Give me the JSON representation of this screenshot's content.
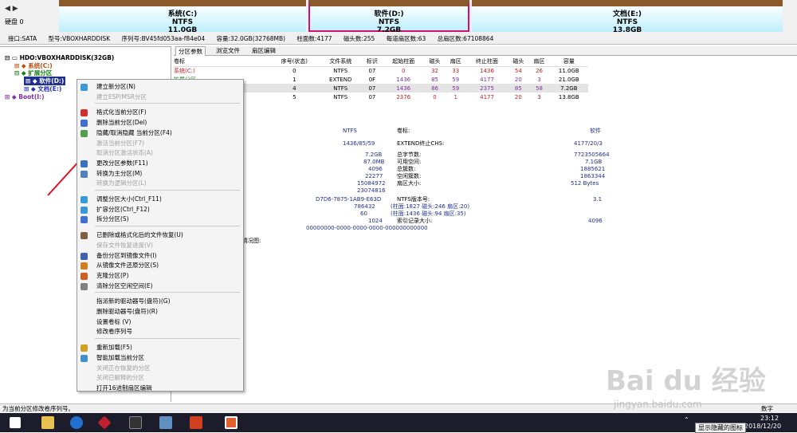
{
  "header": {
    "nav_left": "◀",
    "nav_right": "▶",
    "disk_label": "硬盘 0"
  },
  "partitions": [
    {
      "name": "系统(C:)",
      "fs": "NTFS",
      "size": "11.0GB"
    },
    {
      "name": "软件(D:)",
      "fs": "NTFS",
      "size": "7.2GB"
    },
    {
      "name": "文档(E:)",
      "fs": "NTFS",
      "size": "13.8GB"
    }
  ],
  "info": [
    "接口:SATA",
    "型号:VBOXHARDDISK",
    "序列号:BV45fd053aa-f84e04",
    "容量:32.0GB(32768MB)",
    "柱面数:4177",
    "磁头数:255",
    "每道扇区数:63",
    "总扇区数:67108864"
  ],
  "tree": {
    "root": "HDO:VBOXHARDDISK(32GB)",
    "c": "系统(C:)",
    "ext": "扩展分区",
    "d": "软件(D:)",
    "e": "文档(E:)",
    "boot": "Boot(I:)"
  },
  "tabs": [
    "分区参数",
    "浏览文件",
    "扇区编辑"
  ],
  "table": {
    "headers": [
      "卷标",
      "序号(状态)",
      "文件系统",
      "标识",
      "起始柱面",
      "磁头",
      "扇区",
      "终止柱面",
      "磁头",
      "扇区",
      "容量"
    ],
    "rows": [
      [
        "系统(C:)",
        "0",
        "NTFS",
        "07",
        "0",
        "32",
        "33",
        "1436",
        "54",
        "26",
        "11.0GB"
      ],
      [
        "扩展分区",
        "1",
        "EXTEND",
        "0F",
        "1436",
        "85",
        "59",
        "4177",
        "20",
        "3",
        "21.0GB"
      ],
      [
        "",
        "4",
        "NTFS",
        "07",
        "1436",
        "86",
        "59",
        "2375",
        "85",
        "58",
        "7.2GB"
      ],
      [
        "",
        "5",
        "NTFS",
        "07",
        "2376",
        "0",
        "1",
        "4177",
        "20",
        "3",
        "13.8GB"
      ]
    ]
  },
  "detail": {
    "fs": "NTFS",
    "vol_label": "卷标:",
    "vol_value": "软件",
    "chs": "1436/85/59",
    "ext_end_label": "EXTEND终止CHS:",
    "ext_end_value": "4177/20/3",
    "l1": [
      "7.2GB",
      "总字节数:",
      "7723505664"
    ],
    "l2": [
      "87.0MB",
      "可用空间:",
      "7.1GB"
    ],
    "l3": [
      "4096",
      "总簇数:",
      "1885621"
    ],
    "l4": [
      "22277",
      "空闲簇数:",
      "1863344"
    ],
    "l5": [
      "15084972",
      "扇区大小:",
      "512 Bytes"
    ],
    "l6": [
      "23074816",
      "",
      ""
    ],
    "l7": [
      "D7D6-7875-1AB9-E63D",
      "NTFS版本号:",
      "3.1"
    ],
    "l8": [
      "786432",
      "(柱面:1827 磁头:246 扇区:20)",
      ""
    ],
    "l9": [
      "60",
      "(柱面:1436 磁头:94 扇区:35)",
      ""
    ],
    "l10": [
      "1024",
      "索引记录大小:",
      "4096"
    ],
    "l11": [
      "00000000-0000-0000-0000-000000000000",
      "",
      ""
    ],
    "usage": "使用情况图:"
  },
  "menu": [
    {
      "label": "建立新分区(N)",
      "dis": false,
      "color": "#3a9ad9"
    },
    {
      "label": "建立ESP/MSR分区",
      "dis": true,
      "color": ""
    },
    {
      "label": "格式化当前分区(F)",
      "dis": false,
      "color": "#d03030"
    },
    {
      "label": "删除当前分区(Del)",
      "dis": false,
      "color": "#4070d0"
    },
    {
      "label": "隐藏/取消隐藏 当前分区(F4)",
      "dis": false,
      "color": "#50a050"
    },
    {
      "label": "激活当前分区(F7)",
      "dis": true,
      "color": ""
    },
    {
      "label": "取消分区激活状态(A)",
      "dis": true,
      "color": ""
    },
    {
      "label": "更改分区参数(F11)",
      "dis": false,
      "color": "#3a70c0"
    },
    {
      "label": "转换为主分区(M)",
      "dis": false,
      "color": "#5080c0"
    },
    {
      "label": "转换为逻辑分区(L)",
      "dis": true,
      "color": ""
    },
    {
      "label": "调整分区大小(Ctrl_F11)",
      "dis": false,
      "color": "#3a9ad9"
    },
    {
      "label": "扩容分区(Ctrl_F12)",
      "dis": false,
      "color": "#3a9ad9"
    },
    {
      "label": "拆分分区(S)",
      "dis": false,
      "color": "#4070d0"
    },
    {
      "label": "已删除或格式化后的文件恢复(U)",
      "dis": false,
      "color": "#806040"
    },
    {
      "label": "保存文件恢复进度(V)",
      "dis": true,
      "color": ""
    },
    {
      "label": "备份分区到镜像文件(I)",
      "dis": false,
      "color": "#4060b0"
    },
    {
      "label": "从镜像文件还原分区(S)",
      "dis": false,
      "color": "#d08020"
    },
    {
      "label": "克隆分区(P)",
      "dis": false,
      "color": "#d06020"
    },
    {
      "label": "清除分区空闲空间(E)",
      "dis": false,
      "color": "#808080"
    },
    {
      "label": "指派新的驱动器号(盘符)(G)",
      "dis": false,
      "color": ""
    },
    {
      "label": "删除驱动器号(盘符)(R)",
      "dis": false,
      "color": ""
    },
    {
      "label": "设置卷标 (V)",
      "dis": false,
      "color": ""
    },
    {
      "label": "修改卷序列号",
      "dis": false,
      "color": ""
    },
    {
      "label": "重新加载(F5)",
      "dis": false,
      "color": "#d0a020"
    },
    {
      "label": "智能加载当前分区",
      "dis": false,
      "color": "#4090d0"
    },
    {
      "label": "关闭正在恢复的分区",
      "dis": true,
      "color": ""
    },
    {
      "label": "关闭已解释的分区",
      "dis": true,
      "color": ""
    },
    {
      "label": "打开16进制扇区编辑",
      "dis": false,
      "color": ""
    }
  ],
  "status": "为当前分区修改卷序列号。",
  "tray": {
    "time": "23:12",
    "date": "2018/12/20",
    "tooltip": "显示隐藏的图标",
    "ime": "数字"
  },
  "watermark": {
    "brand": "Bai du 经验",
    "url": "jingyan.baidu.com"
  }
}
